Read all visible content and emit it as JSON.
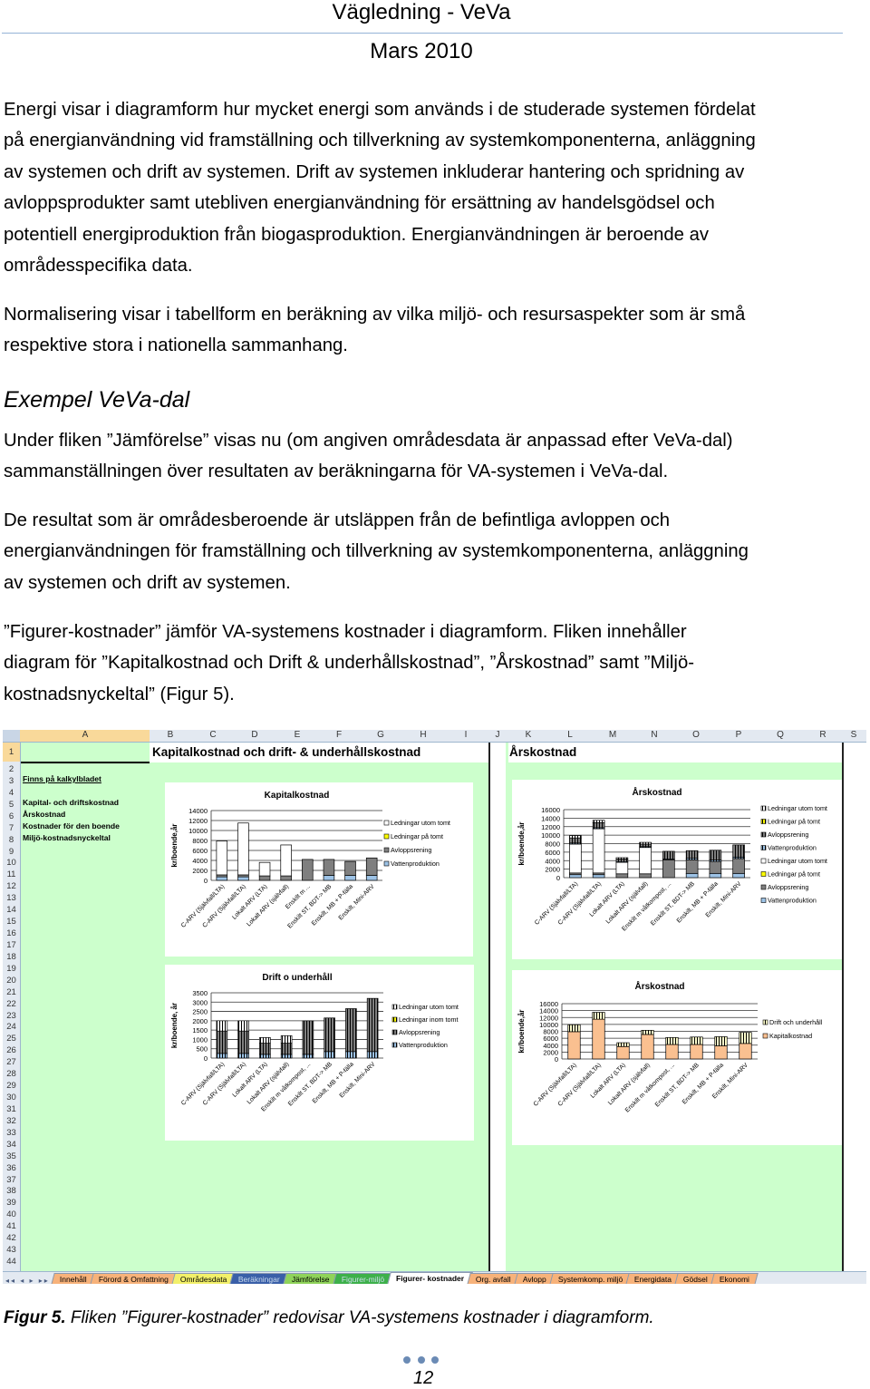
{
  "header": {
    "title": "Vägledning - VeVa",
    "date": "Mars 2010"
  },
  "paragraphs": [
    [
      "Energi visar i diagramform hur mycket energi som används i de studerade systemen fördelat",
      "på energianvändning vid framställning och tillverkning av systemkomponenterna, anläggning",
      "av systemen och drift av systemen. Drift av systemen inkluderar hantering och spridning av",
      "avloppsprodukter samt utebliven energianvändning för ersättning av handelsgödsel och",
      "potentiell energiproduktion från biogasproduktion. Energianvändningen är beroende av",
      "områdesspecifika data."
    ],
    [
      "Normalisering visar i tabellform en beräkning av vilka miljö- och resursaspekter som är små",
      "respektive stora i nationella sammanhang."
    ],
    [
      "Under fliken ”Jämförelse” visas nu (om angiven områdesdata är anpassad efter VeVa-dal)",
      "sammanställningen över resultaten av beräkningarna för VA-systemen i VeVa-dal."
    ],
    [
      "De resultat som är områdesberoende är utsläppen från de befintliga avloppen och",
      "energianvändningen för framställning och tillverkning av systemkomponenterna, anläggning",
      "av systemen och drift av systemen."
    ],
    [
      "”Figurer-kostnader” jämför VA-systemens kostnader i diagramform. Fliken innehåller",
      "diagram för ”Kapitalkostnad och Drift & underhållskostnad”, ”Årskostnad” samt ”Miljö-",
      "kostnadsnyckeltal” (Figur 5)."
    ]
  ],
  "heading": "Exempel VeVa-dal",
  "spreadsheet": {
    "columns": [
      "A",
      "B",
      "C",
      "D",
      "E",
      "F",
      "G",
      "H",
      "I",
      "J",
      "K",
      "L",
      "M",
      "N",
      "O",
      "P",
      "Q",
      "R",
      "S"
    ],
    "rows": [
      "1",
      "2",
      "3",
      "4",
      "5",
      "6",
      "7",
      "8",
      "9",
      "10",
      "11",
      "12",
      "13",
      "14",
      "15",
      "16",
      "17",
      "18",
      "19",
      "20",
      "21",
      "22",
      "23",
      "24",
      "25",
      "26",
      "27",
      "28",
      "29",
      "30",
      "31",
      "32",
      "33",
      "34",
      "35",
      "36",
      "37",
      "38",
      "39",
      "40",
      "41",
      "42",
      "43",
      "44"
    ],
    "b1_title": "Kapitalkostnad och drift- & underhållskostnad",
    "k1_title": "Årskostnad",
    "sidebar_heading": "Finns på kalkylbladet",
    "sidebar_items": [
      "Kapital- och driftskostnad",
      "Årskostnad",
      "Kostnader för den boende",
      "Miljö-kostnadsnyckeltal"
    ],
    "tab_nav": "◂◂ ◂ ▸ ▸▸",
    "tabs": [
      {
        "label": "Innehåll",
        "color": "#f7b27a"
      },
      {
        "label": "Förord & Omfattning",
        "color": "#f7b27a"
      },
      {
        "label": "Områdesdata",
        "color": "#f2f06a"
      },
      {
        "label": "Beräkningar",
        "color": "#3a5fa8"
      },
      {
        "label": "Jämförelse",
        "color": "#8fd35a"
      },
      {
        "label": "Figurer-miljö",
        "color": "#3db04a"
      },
      {
        "label": "Figurer- kostnader",
        "color": "#ffffff",
        "active": true
      },
      {
        "label": "Org. avfall",
        "color": "#f7b27a"
      },
      {
        "label": "Avlopp",
        "color": "#f7b27a"
      },
      {
        "label": "Systemkomp. miljö",
        "color": "#f7b27a"
      },
      {
        "label": "Energidata",
        "color": "#f7b27a"
      },
      {
        "label": "Gödsel",
        "color": "#f7b27a"
      },
      {
        "label": "Ekonomi",
        "color": "#f7b27a"
      }
    ]
  },
  "chart_data": [
    {
      "type": "bar",
      "stacked": true,
      "title": "Kapitalkostnad",
      "ylabel": "kr/boende,år",
      "ylim": [
        0,
        14000
      ],
      "yticks": [
        "0",
        "2000",
        "4000",
        "6000",
        "8000",
        "10000",
        "12000",
        "14000"
      ],
      "grid": true,
      "legend": "right",
      "categories": [
        "C-ARV (Självfall/LTA)",
        "C-ARV (Självfall/LTA)",
        "Lokalt ARV (LTA)",
        "Lokalt ARV (självfall)",
        "Enskilt m ...",
        "Enskilt ST, BDT-> MB",
        "Enskilt, MB + P-fälla",
        "Enskilt, Mini-ARV"
      ],
      "series": [
        {
          "name": "Vattenproduktion",
          "color": "#9dc3e6",
          "values": [
            700,
            700,
            0,
            0,
            0,
            1000,
            1000,
            1000
          ]
        },
        {
          "name": "Avloppsrening",
          "color": "#7f7f7f",
          "values": [
            400,
            400,
            900,
            900,
            4200,
            3200,
            2800,
            3500
          ]
        },
        {
          "name": "Ledningar på tomt",
          "color": "#ffff00",
          "values": [
            0,
            0,
            0,
            0,
            0,
            0,
            0,
            0
          ]
        },
        {
          "name": "Ledningar utom tomt",
          "color": "#ffffff",
          "values": [
            6800,
            10400,
            2700,
            6200,
            0,
            0,
            0,
            0
          ]
        }
      ]
    },
    {
      "type": "bar",
      "stacked": true,
      "title": "Drift o underhåll",
      "ylabel": "kr/boende, år",
      "ylim": [
        0,
        3500
      ],
      "yticks": [
        "0",
        "500",
        "1000",
        "1500",
        "2000",
        "2500",
        "3000",
        "3500"
      ],
      "grid": true,
      "legend": "right",
      "categories": [
        "C-ARV (Självfall/LTA)",
        "C-ARV (Självfall/LTA)",
        "Lokalt ARV (LTA)",
        "Lokalt ARV (självfall)",
        "Enskilt m våtkompost, ...",
        "Enskilt ST, BDT-> MB",
        "Enskilt, MB + P-fälla",
        "Enskilt, Mini-ARV"
      ],
      "series": [
        {
          "name": "Vattenproduktion",
          "color": "#9dc3e6",
          "hatched": true,
          "values": [
            250,
            250,
            200,
            200,
            200,
            350,
            350,
            350
          ]
        },
        {
          "name": "Avloppsrening",
          "color": "#7f7f7f",
          "hatched": true,
          "values": [
            1200,
            1200,
            600,
            600,
            1800,
            1800,
            2300,
            2850
          ]
        },
        {
          "name": "Ledningar inom tomt",
          "color": "#ffff00",
          "hatched": true,
          "values": [
            0,
            0,
            0,
            0,
            0,
            0,
            0,
            0
          ]
        },
        {
          "name": "Ledningar utom tomt",
          "color": "#ffffff",
          "hatched": true,
          "values": [
            550,
            550,
            300,
            400,
            0,
            0,
            0,
            0
          ]
        }
      ]
    },
    {
      "type": "bar",
      "stacked": true,
      "title": "Årskostnad",
      "ylabel": "kr/boende,år",
      "ylim": [
        0,
        16000
      ],
      "yticks": [
        "0",
        "2000",
        "4000",
        "6000",
        "8000",
        "10000",
        "12000",
        "14000",
        "16000"
      ],
      "grid": true,
      "legend": "right",
      "categories": [
        "C-ARV (Självfall/LTA)",
        "C-ARV (Självfall/LTA)",
        "Lokalt ARV (LTA)",
        "Lokalt ARV (självfall)",
        "Enskilt m våtkompost, ...",
        "Enskilt ST, BDT-> MB",
        "Enskilt, MB + P-fälla",
        "Enskilt, Mini-ARV"
      ],
      "series": [
        {
          "name": "Vattenproduktion",
          "color": "#9dc3e6",
          "values": [
            700,
            700,
            0,
            0,
            0,
            1000,
            1000,
            1000
          ]
        },
        {
          "name": "Avloppsrening",
          "color": "#7f7f7f",
          "values": [
            400,
            400,
            900,
            900,
            4200,
            3200,
            2800,
            3500
          ]
        },
        {
          "name": "Ledningar på tomt",
          "color": "#ffff00",
          "values": [
            0,
            0,
            0,
            0,
            0,
            0,
            0,
            0
          ]
        },
        {
          "name": "Ledningar utom tomt",
          "color": "#ffffff",
          "values": [
            6800,
            10400,
            2700,
            6200,
            0,
            0,
            0,
            0
          ]
        },
        {
          "name": "Vattenproduktion",
          "color": "#9dc3e6",
          "hatched": true,
          "values": [
            250,
            250,
            200,
            200,
            200,
            350,
            350,
            350
          ]
        },
        {
          "name": "Avloppsrening",
          "color": "#7f7f7f",
          "hatched": true,
          "values": [
            1200,
            1200,
            600,
            600,
            1800,
            1800,
            2300,
            2850
          ]
        },
        {
          "name": "Ledningar på tomt",
          "color": "#ffff00",
          "hatched": true,
          "values": [
            0,
            0,
            0,
            0,
            0,
            0,
            0,
            0
          ]
        },
        {
          "name": "Ledningar utom tomt",
          "color": "#ffffff",
          "hatched": true,
          "values": [
            550,
            550,
            300,
            400,
            0,
            0,
            0,
            0
          ]
        }
      ]
    },
    {
      "type": "bar",
      "stacked": true,
      "title": "Årskostnad",
      "ylabel": "kr/boende,år",
      "ylim": [
        0,
        16000
      ],
      "yticks": [
        "0",
        "2000",
        "4000",
        "6000",
        "8000",
        "10000",
        "12000",
        "14000",
        "16000"
      ],
      "grid": true,
      "legend": "right",
      "categories": [
        "C-ARV (Självfall/LTA)",
        "C-ARV (Självfall/LTA)",
        "Lokalt ARV (LTA)",
        "Lokalt ARV (självfall)",
        "Enskilt m våtkompost, ...",
        "Enskilt ST, BDT-> MB",
        "Enskilt, MB + P-fälla",
        "Enskilt, Mini-ARV"
      ],
      "series": [
        {
          "name": "Kapitalkostnad",
          "color": "#fac090",
          "values": [
            7900,
            11500,
            3600,
            7100,
            4200,
            4200,
            3800,
            4500
          ]
        },
        {
          "name": "Drift och underhåll",
          "color": "#ffffcc",
          "hatched": true,
          "values": [
            2000,
            2000,
            1100,
            1200,
            2000,
            2150,
            2650,
            3200
          ]
        }
      ]
    }
  ],
  "caption": {
    "label": "Figur 5.",
    "text": " Fliken ”Figurer-kostnader” redovisar VA-systemens kostnader i diagramform."
  },
  "page_number": "12"
}
